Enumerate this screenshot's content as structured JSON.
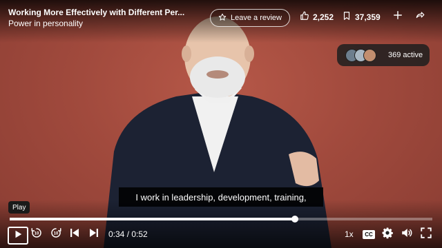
{
  "video": {
    "title": "Working More Effectively with Different Per...",
    "subtitle": "Power in personality"
  },
  "header": {
    "review_label": "Leave a review",
    "likes": "2,252",
    "saves": "37,359"
  },
  "viewers": {
    "active_label": "369 active"
  },
  "caption": {
    "text": "I work in leadership, development, training,"
  },
  "tooltip": {
    "text": "Play"
  },
  "controls": {
    "time": "0:34 / 0:52",
    "speed": "1x",
    "cc_label": "CC",
    "rewind_seconds": "10",
    "forward_seconds": "10",
    "progress_fraction": 0.675
  },
  "icons": {
    "review": "star-icon",
    "likes": "thumbs-up-icon",
    "saves": "bookmark-icon",
    "add": "plus-icon",
    "share": "share-arrow-icon",
    "play": "play-icon",
    "rewind": "rewind-10-icon",
    "forward": "forward-10-icon",
    "prev": "skip-previous-icon",
    "next": "skip-next-icon",
    "settings": "gear-icon",
    "volume": "volume-icon",
    "fullscreen": "fullscreen-icon"
  },
  "colors": {
    "backdrop": "#a24a3e",
    "overlay": "#000000"
  }
}
